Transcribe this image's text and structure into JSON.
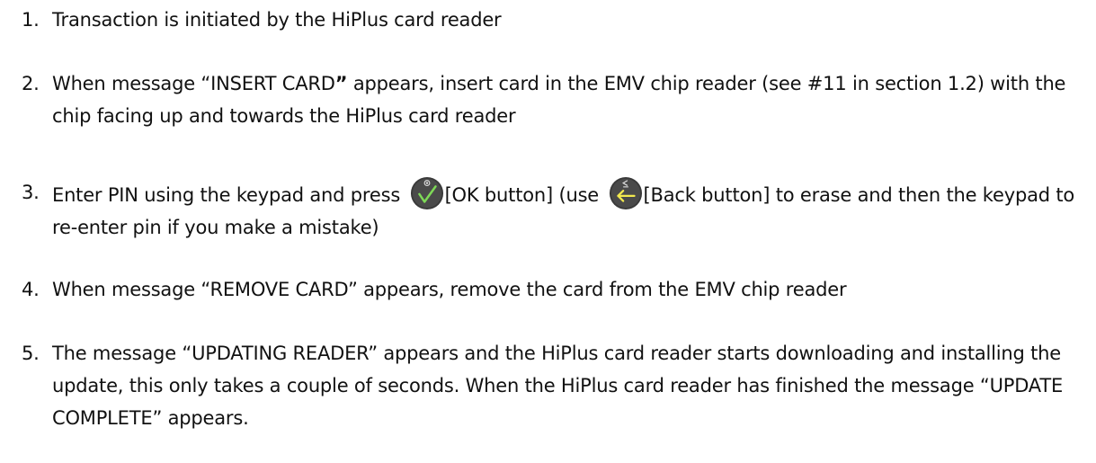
{
  "steps": [
    {
      "number": "1.",
      "text": "Transaction is initiated by the HiPlus card reader"
    },
    {
      "number": "2.",
      "text_a": "When message “INSERT CARD",
      "text_bold": "”",
      "text_b": " appears, insert card in the EMV chip reader (see #11 in section 1.2)  with the chip facing up and towards the HiPlus card reader"
    },
    {
      "number": "3.",
      "text_a": "Enter PIN using the keypad and press ",
      "ok_label": "[OK button] (use ",
      "back_label": "[Back button] to erase and then the keypad to re-enter pin if you make a mistake)"
    },
    {
      "number": "4.",
      "text": "When message “REMOVE CARD” appears, remove the card from the EMV chip reader"
    },
    {
      "number": "5.",
      "text": "The message “UPDATING READER” appears and the HiPlus card reader starts downloading and installing the update, this only takes a couple of seconds. When the HiPlus card reader has finished the message “UPDATE COMPLETE” appears."
    }
  ],
  "icons": {
    "ok": "ok-button-icon",
    "back": "back-button-icon"
  },
  "colors": {
    "text": "#111111",
    "button_face": "#3a3a3a",
    "ok_check": "#7ed957",
    "back_arrow": "#f2e94e"
  }
}
